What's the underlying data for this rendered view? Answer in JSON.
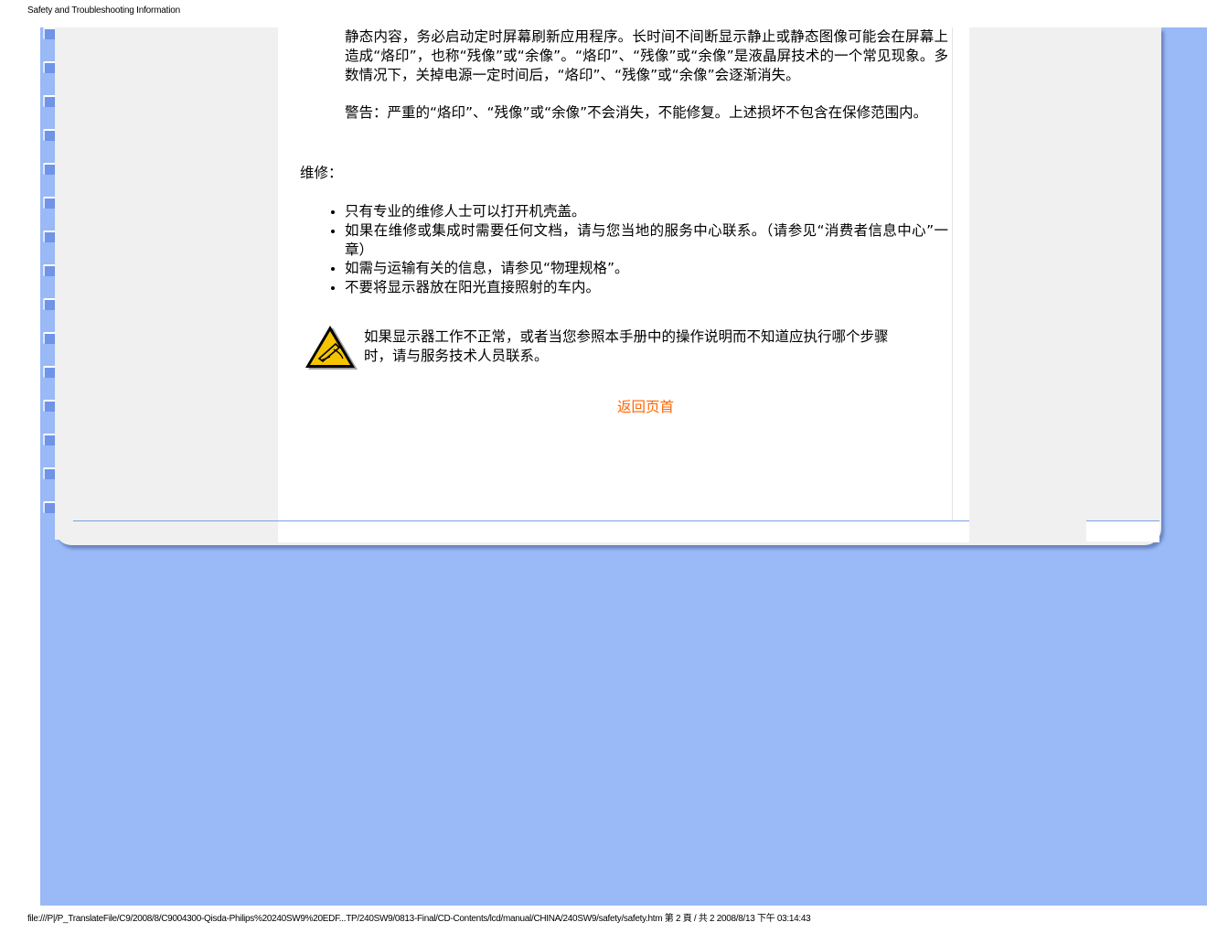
{
  "header": {
    "title": "Safety and Troubleshooting Information"
  },
  "content": {
    "burn_in_paragraph": "静态内容，务必启动定时屏幕刷新应用程序。长时间不间断显示静止或静态图像可能会在屏幕上造成“烙印”，也称“残像”或“余像”。“烙印”、“残像”或“余像”是液晶屏技术的一个常见现象。多数情况下，关掉电源一定时间后，“烙印”、“残像”或“余像”会逐渐消失。",
    "warning_paragraph": "警告：严重的“烙印”、“残像”或“余像”不会消失，不能修复。上述损坏不包含在保修范围内。",
    "repair_heading": "维修：",
    "repair_items": [
      "只有专业的维修人士可以打开机壳盖。",
      "如果在维修或集成时需要任何文档，请与您当地的服务中心联系。（请参见“消费者信息中心”一章）",
      "如需与运输有关的信息，请参见“物理规格”。",
      "不要将显示器放在阳光直接照射的车内。"
    ],
    "caution_text": "如果显示器工作不正常，或者当您参照本手册中的操作说明而不知道应执行哪个步骤时，请与服务技术人员联系。",
    "back_to_top": "返回页首"
  },
  "colors": {
    "background_blue": "#99b9f7",
    "panel_gray": "#f0f0f0",
    "link_orange": "#ff6600"
  },
  "footer": {
    "url": "file:///P|/P_TranslateFile/C9/2008/8/C9004300-Qisda-Philips%20240SW9%20EDF...TP/240SW9/0813-Final/CD-Contents/lcd/manual/CHINA/240SW9/safety/safety.htm 第 2 頁 / 共 2 2008/8/13 下午 03:14:43"
  }
}
